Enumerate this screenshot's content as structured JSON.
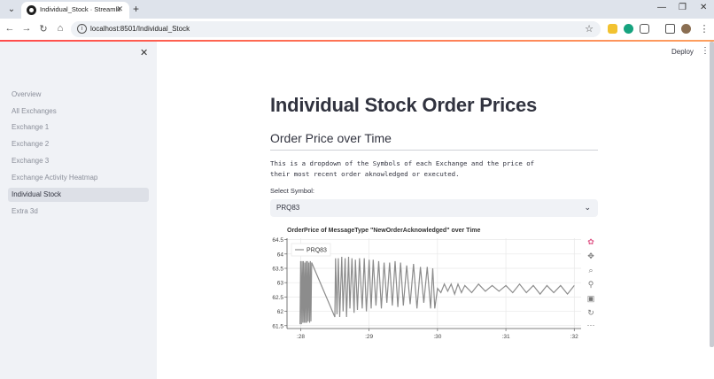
{
  "browser": {
    "tab_title": "Individual_Stock · Streamlit",
    "url": "localhost:8501/Individual_Stock"
  },
  "app": {
    "deploy_label": "Deploy"
  },
  "sidebar": {
    "items": [
      {
        "label": "Overview"
      },
      {
        "label": "All Exchanges"
      },
      {
        "label": "Exchange 1"
      },
      {
        "label": "Exchange 2"
      },
      {
        "label": "Exchange 3"
      },
      {
        "label": "Exchange Activity Heatmap"
      },
      {
        "label": "Individual Stock"
      },
      {
        "label": "Extra 3d"
      }
    ],
    "active": "Individual Stock"
  },
  "page": {
    "title": "Individual Stock Order Prices",
    "subheader": "Order Price over Time",
    "description_line1": "This is a dropdown of the Symbols of each Exchange and the price of",
    "description_line2": "their most recent order aknowledged or executed.",
    "select_label": "Select Symbol:",
    "select_value": "PRQ83"
  },
  "colors": {
    "accent": "#ff4b4b",
    "sidebar_bg": "#f0f2f6",
    "text": "#31333f",
    "series": "#8c8c8c"
  },
  "chart_data": {
    "type": "line",
    "title": "OrderPrice of MessageType \"NewOrderAcknowledged\" over Time",
    "legend": "PRQ83",
    "legend_position": "top-left",
    "x_ticks": [
      ":28",
      ":29",
      ":30",
      ":31",
      ":32"
    ],
    "y_ticks": [
      "61.5",
      "62",
      "62.5",
      "63",
      "63.5",
      "64",
      "64.5"
    ],
    "xlim": [
      27.8,
      32.1
    ],
    "ylim": [
      61.4,
      64.55
    ],
    "series": [
      {
        "name": "PRQ83",
        "x": [
          27.99,
          28.0,
          28.01,
          28.02,
          28.03,
          28.04,
          28.05,
          28.06,
          28.07,
          28.08,
          28.09,
          28.1,
          28.11,
          28.12,
          28.13,
          28.14,
          28.15,
          28.16,
          28.5,
          28.51,
          28.53,
          28.55,
          28.57,
          28.6,
          28.62,
          28.65,
          28.67,
          28.7,
          28.72,
          28.75,
          28.78,
          28.8,
          28.83,
          28.86,
          28.9,
          28.93,
          28.96,
          29.0,
          29.03,
          29.06,
          29.1,
          29.14,
          29.18,
          29.22,
          29.26,
          29.3,
          29.34,
          29.38,
          29.42,
          29.46,
          29.5,
          29.55,
          29.6,
          29.65,
          29.7,
          29.75,
          29.8,
          29.85,
          29.9,
          29.93,
          29.96,
          30.0,
          30.05,
          30.1,
          30.15,
          30.2,
          30.25,
          30.3,
          30.35,
          30.4,
          30.5,
          30.6,
          30.7,
          30.8,
          30.9,
          31.0,
          31.1,
          31.2,
          31.3,
          31.4,
          31.5,
          31.6,
          31.7,
          31.8,
          31.9,
          32.0
        ],
        "y": [
          61.55,
          63.75,
          61.55,
          63.75,
          61.6,
          63.75,
          61.6,
          63.7,
          61.6,
          63.75,
          61.6,
          63.75,
          61.65,
          63.7,
          61.6,
          63.75,
          61.65,
          63.7,
          61.8,
          63.85,
          61.9,
          63.85,
          61.8,
          63.9,
          62.0,
          63.85,
          61.8,
          63.9,
          62.1,
          63.85,
          61.95,
          63.8,
          62.05,
          63.85,
          62.1,
          63.85,
          62.0,
          63.8,
          62.1,
          63.8,
          62.2,
          63.75,
          62.1,
          63.7,
          62.3,
          63.7,
          62.2,
          63.75,
          62.15,
          63.7,
          62.2,
          63.6,
          62.25,
          63.65,
          62.1,
          63.55,
          62.3,
          63.55,
          62.1,
          63.5,
          62.1,
          62.8,
          62.65,
          62.95,
          62.7,
          62.95,
          62.6,
          62.95,
          62.65,
          62.9,
          62.65,
          62.95,
          62.7,
          62.9,
          62.7,
          62.9,
          62.65,
          62.95,
          62.65,
          62.9,
          62.6,
          62.9,
          62.65,
          62.9,
          62.6,
          62.9
        ]
      }
    ],
    "grid": true
  }
}
